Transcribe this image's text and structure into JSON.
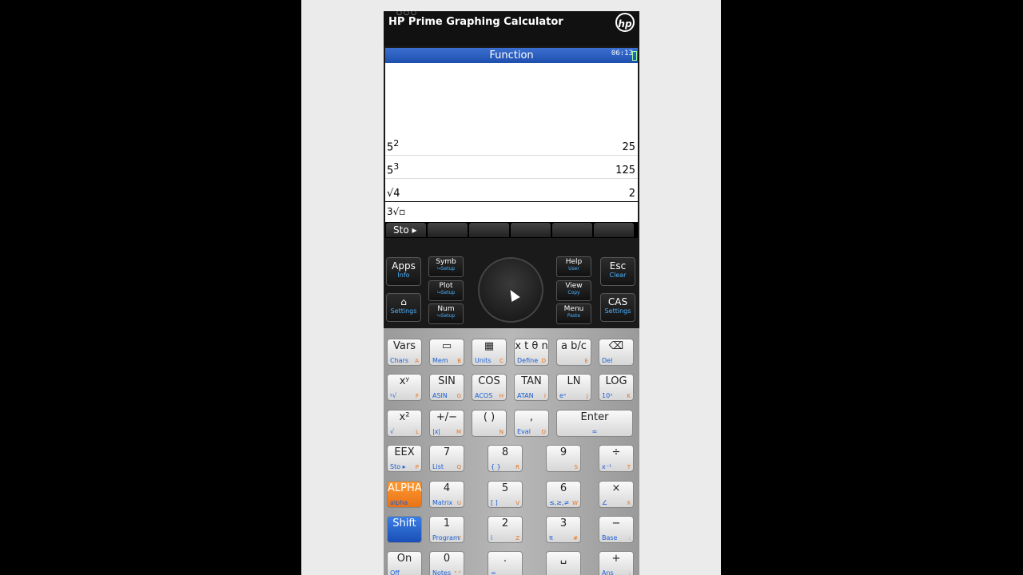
{
  "app_title": "HP Prime Graphing Calculator",
  "logo_text": "hp",
  "screen": {
    "mode": "Function",
    "clock": "06:13",
    "history": [
      {
        "expr_base": "5",
        "expr_sup": "2",
        "result": "25"
      },
      {
        "expr_base": "5",
        "expr_sup": "3",
        "result": "125"
      },
      {
        "expr_base": "√4",
        "expr_sup": "",
        "result": "2"
      }
    ],
    "entry": "3√▫",
    "softkeys": [
      "Sto ▸",
      "",
      "",
      "",
      "",
      ""
    ]
  },
  "top_keys": {
    "apps": {
      "main": "Apps",
      "sub": "Info"
    },
    "home": {
      "main": "⌂",
      "sub": "Settings"
    },
    "symb": {
      "main": "Symb",
      "sub": "↪Setup"
    },
    "plot": {
      "main": "Plot",
      "sub": "↪Setup"
    },
    "num": {
      "main": "Num",
      "sub": "↪Setup"
    },
    "help": {
      "main": "Help",
      "sub": "User"
    },
    "view": {
      "main": "View",
      "sub": "Copy"
    },
    "menu": {
      "main": "Menu",
      "sub": "Paste"
    },
    "esc": {
      "main": "Esc",
      "sub": "Clear"
    },
    "cas": {
      "main": "CAS",
      "sub": "Settings"
    }
  },
  "keys": [
    {
      "main": "Vars",
      "subl": "Chars",
      "subr": "A"
    },
    {
      "main": "▭",
      "subl": "Mem",
      "subr": "B"
    },
    {
      "main": "▦",
      "subl": "Units",
      "subr": "C"
    },
    {
      "main": "x t θ n",
      "subl": "Define",
      "subr": "D"
    },
    {
      "main": "a b/c",
      "subl": "",
      "subr": "E"
    },
    {
      "main": "⌫",
      "subl": "Del",
      "subr": ""
    },
    {
      "main": "xʸ",
      "subl": "ʸ√",
      "subr": "F"
    },
    {
      "main": "SIN",
      "subl": "ASIN",
      "subr": "G"
    },
    {
      "main": "COS",
      "subl": "ACOS",
      "subr": "H"
    },
    {
      "main": "TAN",
      "subl": "ATAN",
      "subr": "I"
    },
    {
      "main": "LN",
      "subl": "eˣ",
      "subr": "J"
    },
    {
      "main": "LOG",
      "subl": "10ˣ",
      "subr": "K"
    },
    {
      "main": "x²",
      "subl": "√",
      "subr": "L"
    },
    {
      "main": "+/−",
      "subl": "|x|",
      "subr": "M"
    },
    {
      "main": "( )",
      "subl": "",
      "subr": "N"
    },
    {
      "main": ",",
      "subl": "Eval",
      "subr": "O"
    },
    {
      "main": "EEX",
      "subl": "Sto ▸",
      "subr": "P"
    },
    {
      "main": "7",
      "subl": "List",
      "subr": "Q"
    },
    {
      "main": "8",
      "subl": "{ }",
      "subr": "R"
    },
    {
      "main": "9",
      "subl": "",
      "subr": "S"
    },
    {
      "main": "÷",
      "subl": "x⁻¹",
      "subr": "T"
    },
    {
      "main": "ALPHA",
      "subl": "alpha",
      "subr": ""
    },
    {
      "main": "4",
      "subl": "Matrix",
      "subr": "U"
    },
    {
      "main": "5",
      "subl": "[ ]",
      "subr": "V"
    },
    {
      "main": "6",
      "subl": "≤,≥,≠",
      "subr": "W"
    },
    {
      "main": "×",
      "subl": "∠",
      "subr": "X"
    },
    {
      "main": "Shift",
      "subl": "",
      "subr": ""
    },
    {
      "main": "1",
      "subl": "Program",
      "subr": "Y"
    },
    {
      "main": "2",
      "subl": "i",
      "subr": "Z"
    },
    {
      "main": "3",
      "subl": "π",
      "subr": "#"
    },
    {
      "main": "−",
      "subl": "Base",
      "subr": ":"
    },
    {
      "main": "On",
      "subl": "Off",
      "subr": ""
    },
    {
      "main": "0",
      "subl": "Notes",
      "subr": "\" \""
    },
    {
      "main": ".",
      "subl": "=",
      "subr": ""
    },
    {
      "main": "␣",
      "subl": "_",
      "subr": ""
    },
    {
      "main": "+",
      "subl": "Ans",
      "subr": ";"
    }
  ],
  "enter_key": {
    "main": "Enter",
    "sub": "≈"
  }
}
